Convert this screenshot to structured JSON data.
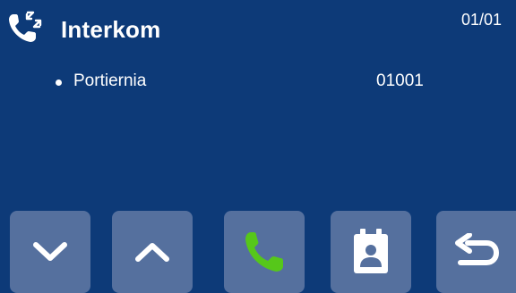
{
  "header": {
    "title": "Interkom",
    "page_indicator": "01/01",
    "icon": "phone-transfer-icon"
  },
  "entries": [
    {
      "name": "Portiernia",
      "code": "01001"
    }
  ],
  "toolbar": {
    "buttons": [
      {
        "icon": "chevron-down-icon"
      },
      {
        "icon": "chevron-up-icon"
      },
      {
        "icon": "phone-icon",
        "color": "#56c71a"
      },
      {
        "icon": "contact-card-icon"
      },
      {
        "icon": "back-arrow-icon"
      }
    ]
  },
  "colors": {
    "background": "#0d3a78",
    "button": "#55709e",
    "call_accent": "#56c71a",
    "text": "#ffffff"
  }
}
